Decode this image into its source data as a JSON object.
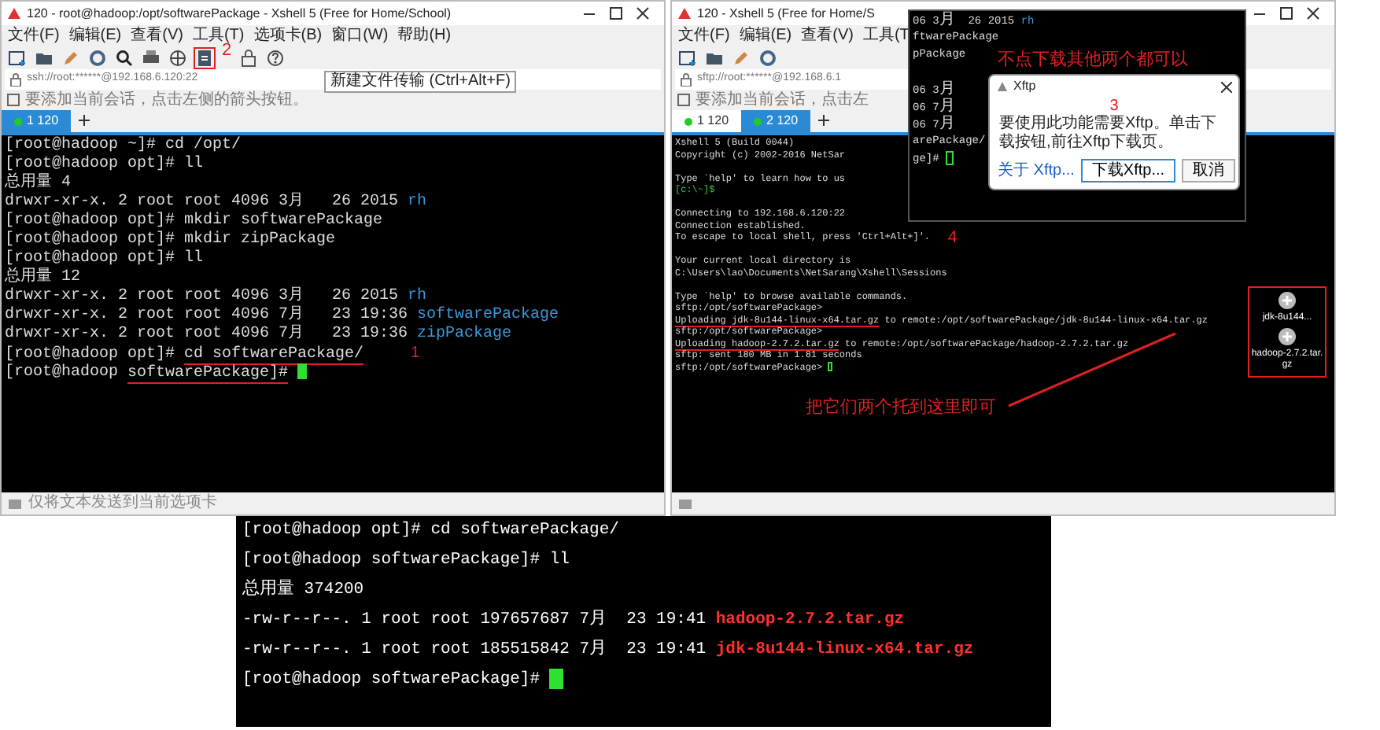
{
  "left_window": {
    "title": "120 - root@hadoop:/opt/softwarePackage - Xshell 5 (Free for Home/School)",
    "menu": [
      "文件(F)",
      "编辑(E)",
      "查看(V)",
      "工具(T)",
      "选项卡(B)",
      "窗口(W)",
      "帮助(H)"
    ],
    "toolbar": {
      "annotation": "2",
      "tooltip": "新建文件传输 (Ctrl+Alt+F)"
    },
    "address": "ssh://root:******@192.168.6.120:22",
    "hint": "要添加当前会话，点击左侧的箭头按钮。",
    "tabs": [
      {
        "label": "1 120",
        "selected": true
      }
    ],
    "terminal": {
      "cursor": true,
      "focused": true,
      "lines": [
        {
          "segments": [
            {
              "text": "[root@hadoop ~]# cd /opt/",
              "kind": "plain"
            }
          ]
        },
        {
          "segments": [
            {
              "text": "[root@hadoop opt]# ll",
              "kind": "plain"
            }
          ]
        },
        {
          "segments": [
            {
              "text": "总用量 4",
              "kind": "plain"
            }
          ]
        },
        {
          "segments": [
            {
              "text": "drwxr-xr-x. 2 root root 4096 3月   26 2015 ",
              "kind": "plain"
            },
            {
              "text": "rh",
              "kind": "dir"
            }
          ]
        },
        {
          "segments": [
            {
              "text": "[root@hadoop opt]# mkdir softwarePackage",
              "kind": "plain"
            }
          ]
        },
        {
          "segments": [
            {
              "text": "[root@hadoop opt]# mkdir zipPackage",
              "kind": "plain"
            }
          ]
        },
        {
          "segments": [
            {
              "text": "[root@hadoop opt]# ll",
              "kind": "plain"
            }
          ]
        },
        {
          "segments": [
            {
              "text": "总用量 12",
              "kind": "plain"
            }
          ]
        },
        {
          "segments": [
            {
              "text": "drwxr-xr-x. 2 root root 4096 3月   26 2015 ",
              "kind": "plain"
            },
            {
              "text": "rh",
              "kind": "dir"
            }
          ]
        },
        {
          "segments": [
            {
              "text": "drwxr-xr-x. 2 root root 4096 7月   23 19:36 ",
              "kind": "plain"
            },
            {
              "text": "softwarePackage",
              "kind": "dir"
            }
          ]
        },
        {
          "segments": [
            {
              "text": "drwxr-xr-x. 2 root root 4096 7月   23 19:36 ",
              "kind": "plain"
            },
            {
              "text": "zipPackage",
              "kind": "dir"
            }
          ]
        },
        {
          "segments": [
            {
              "text": "[root@hadoop opt]# ",
              "kind": "plain"
            },
            {
              "text": "cd softwarePackage/",
              "kind": "marked"
            }
          ],
          "note": "1"
        },
        {
          "segments": [
            {
              "text": "[root@hadoop ",
              "kind": "plain"
            },
            {
              "text": "softwarePackage]#",
              "kind": "marked"
            }
          ]
        }
      ]
    },
    "status": "仅将文本发送到当前选项卡"
  },
  "right_window": {
    "title": "120 - Xshell 5 (Free for Home/S",
    "menu": [
      "文件(F)",
      "编辑(E)",
      "查看(V)",
      "工具(T"
    ],
    "address": "sftp://root:******@192.168.6.1",
    "hint": "要添加当前会话，点击左",
    "tabs": [
      {
        "label": "1 120",
        "selected": false
      },
      {
        "label": "2 120",
        "selected": true
      }
    ],
    "terminal": {
      "cursor": true,
      "focused": false,
      "lines": [
        {
          "segments": [
            {
              "text": "Xshell 5 (Build 0044)",
              "kind": "plain"
            }
          ]
        },
        {
          "segments": [
            {
              "text": "Copyright (c) 2002-2016 NetSar",
              "kind": "plain"
            }
          ]
        },
        {
          "segments": [
            {
              "text": "Type `help' to learn how to us",
              "kind": "plain"
            }
          ],
          "space_before": true
        },
        {
          "segments": [
            {
              "text": "[c:\\~]$",
              "kind": "local"
            }
          ]
        },
        {
          "segments": [
            {
              "text": "Connecting to 192.168.6.120:22",
              "kind": "plain"
            }
          ],
          "space_before": true
        },
        {
          "segments": [
            {
              "text": "Connection established.",
              "kind": "plain"
            }
          ]
        },
        {
          "segments": [
            {
              "text": "To escape to local shell, press 'Ctrl+Alt+]'.",
              "kind": "plain"
            }
          ]
        },
        {
          "segments": [
            {
              "text": "Your current local directory is",
              "kind": "plain"
            }
          ],
          "space_before": true
        },
        {
          "segments": [
            {
              "text": "C:\\Users\\lao\\Documents\\NetSarang\\Xshell\\Sessions",
              "kind": "plain"
            }
          ]
        },
        {
          "segments": [
            {
              "text": "Type `help' to browse available commands.",
              "kind": "plain"
            }
          ],
          "space_before": true
        },
        {
          "segments": [
            {
              "text": "sftp:/opt/softwarePackage>",
              "kind": "plain"
            }
          ]
        },
        {
          "segments": [
            {
              "text": "Uploading jdk-8u144-linux-x64.tar.gz",
              "kind": "marked"
            },
            {
              "text": " to remote:/opt/softwarePackage/jdk-8u144-linux-x64.tar.gz",
              "kind": "plain"
            }
          ]
        },
        {
          "segments": [
            {
              "text": "sftp:/opt/softwarePackage>",
              "kind": "plain"
            }
          ]
        },
        {
          "segments": [
            {
              "text": "Uploading hadoop-2.7.2.tar.gz",
              "kind": "marked"
            },
            {
              "text": " to remote:/opt/softwarePackage/hadoop-2.7.2.tar.gz",
              "kind": "plain"
            }
          ]
        },
        {
          "segments": [
            {
              "text": "sftp: sent 180 MB in 1.81 seconds",
              "kind": "plain"
            }
          ]
        },
        {
          "segments": [
            {
              "text": "sftp:/opt/softwarePackage>",
              "kind": "plain"
            }
          ]
        }
      ]
    },
    "annotation_number": "4",
    "drop_note": "把它们两个托到这里即可",
    "dropped_files": [
      "jdk-8u144...",
      "hadoop-2.7.2.tar.gz"
    ],
    "overlay": {
      "note": "不点下载其他两个都可以",
      "terminal": {
        "cursor": true,
        "focused": false,
        "lines": [
          {
            "segments": [
              {
                "text": "06 3月  26 2015 ",
                "kind": "plain"
              },
              {
                "text": "rh",
                "kind": "dir"
              }
            ]
          },
          {
            "segments": [
              {
                "text": "ftwarePackage",
                "kind": "plain"
              }
            ]
          },
          {
            "segments": [
              {
                "text": "pPackage",
                "kind": "plain"
              }
            ]
          },
          {
            "segments": [
              {
                "text": "06 3月",
                "kind": "plain"
              }
            ],
            "space_before": true
          },
          {
            "segments": [
              {
                "text": "06 7月",
                "kind": "plain"
              }
            ]
          },
          {
            "segments": [
              {
                "text": "06 7月",
                "kind": "plain"
              }
            ]
          },
          {
            "segments": [
              {
                "text": "arePackage/",
                "kind": "plain"
              }
            ]
          },
          {
            "segments": [
              {
                "text": "ge]#",
                "kind": "plain"
              }
            ]
          }
        ]
      },
      "dialog": {
        "title": "Xftp",
        "annotation": "3",
        "message": "要使用此功能需要Xftp。单击下载按钮,前往Xftp下载页。",
        "link": "关于 Xftp...",
        "buttons": [
          {
            "label": "下载Xftp...",
            "kind": "default"
          },
          {
            "label": "取消",
            "kind": "normal"
          }
        ]
      }
    }
  },
  "bottom_terminal": {
    "cursor": true,
    "focused": true,
    "lines": [
      {
        "segments": [
          {
            "text": "[root@hadoop opt]# cd softwarePackage/",
            "kind": "plain"
          }
        ]
      },
      {
        "segments": [
          {
            "text": "[root@hadoop softwarePackage]# ll",
            "kind": "plain"
          }
        ]
      },
      {
        "segments": [
          {
            "text": "总用量 374200",
            "kind": "plain"
          }
        ]
      },
      {
        "segments": [
          {
            "text": "-rw-r--r--. 1 root root 197657687 7月  23 19:41 ",
            "kind": "plain"
          },
          {
            "text": "hadoop-2.7.2.tar.gz",
            "kind": "archive"
          }
        ]
      },
      {
        "segments": [
          {
            "text": "-rw-r--r--. 1 root root 185515842 7月  23 19:41 ",
            "kind": "plain"
          },
          {
            "text": "jdk-8u144-linux-x64.tar.gz",
            "kind": "archive"
          }
        ]
      },
      {
        "segments": [
          {
            "text": "[root@hadoop softwarePackage]#",
            "kind": "plain"
          }
        ]
      }
    ]
  }
}
